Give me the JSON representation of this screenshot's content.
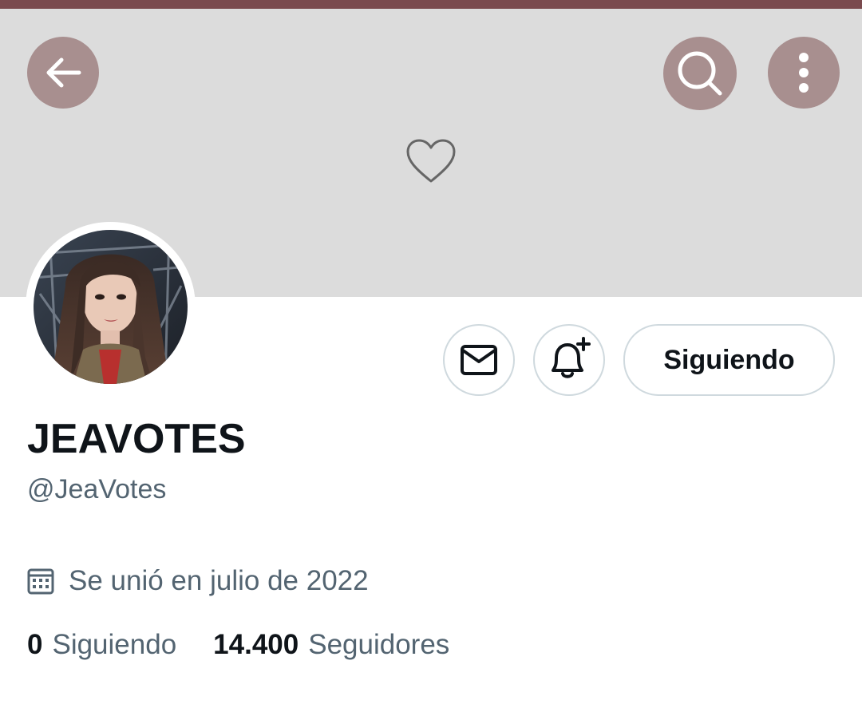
{
  "colors": {
    "status_strip": "#7a4a4e",
    "banner_bg": "#dcdcdc",
    "banner_button_bg": "#a88f8f",
    "text_primary": "#0f1419",
    "text_secondary": "#536471",
    "button_border": "#cfd9de"
  },
  "header": {
    "back_icon": "arrow-left-icon",
    "search_icon": "search-icon",
    "more_icon": "more-vertical-icon"
  },
  "banner": {
    "placeholder_icon": "heart-outline-icon"
  },
  "profile": {
    "avatar_icon": "profile-photo",
    "display_name": "JEAVOTES",
    "handle": "@JeaVotes",
    "joined": "Se unió en julio de 2022",
    "joined_icon": "calendar-icon"
  },
  "actions": {
    "message_icon": "mail-icon",
    "notify_icon": "bell-plus-icon",
    "follow_label": "Siguiendo"
  },
  "stats": {
    "following_count": "0",
    "following_label": "Siguiendo",
    "followers_count": "14.400",
    "followers_label": "Seguidores"
  }
}
